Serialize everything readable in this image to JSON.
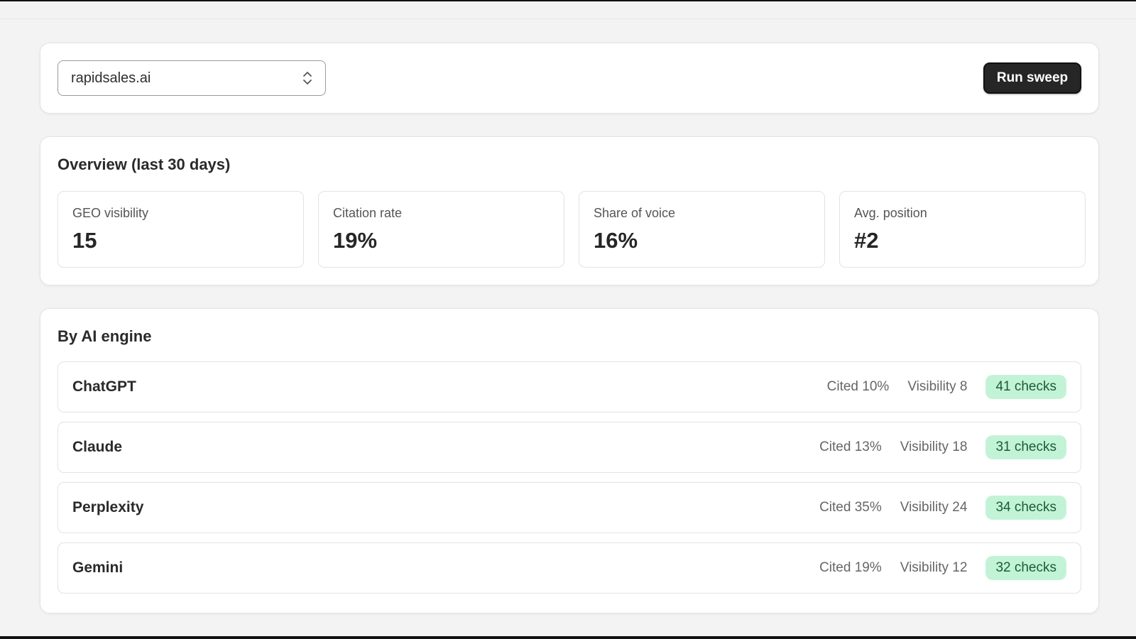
{
  "toolbar": {
    "domain_select_value": "rapidsales.ai",
    "run_label": "Run sweep"
  },
  "overview": {
    "title": "Overview (last 30 days)",
    "stats": [
      {
        "label": "GEO visibility",
        "value": "15"
      },
      {
        "label": "Citation rate",
        "value": "19%"
      },
      {
        "label": "Share of voice",
        "value": "16%"
      },
      {
        "label": "Avg. position",
        "value": "#2"
      }
    ]
  },
  "engines": {
    "title": "By AI engine",
    "rows": [
      {
        "name": "ChatGPT",
        "cited": "Cited 10%",
        "visibility": "Visibility 8",
        "checks": "41 checks"
      },
      {
        "name": "Claude",
        "cited": "Cited 13%",
        "visibility": "Visibility 18",
        "checks": "31 checks"
      },
      {
        "name": "Perplexity",
        "cited": "Cited 35%",
        "visibility": "Visibility 24",
        "checks": "34 checks"
      },
      {
        "name": "Gemini",
        "cited": "Cited 19%",
        "visibility": "Visibility 12",
        "checks": "32 checks"
      }
    ]
  },
  "icons": {
    "select_icon": "chevron-up-down-icon"
  },
  "colors": {
    "badge_bg": "#c3f3d6",
    "badge_text": "#1a5c36",
    "primary_button": "#262626"
  }
}
